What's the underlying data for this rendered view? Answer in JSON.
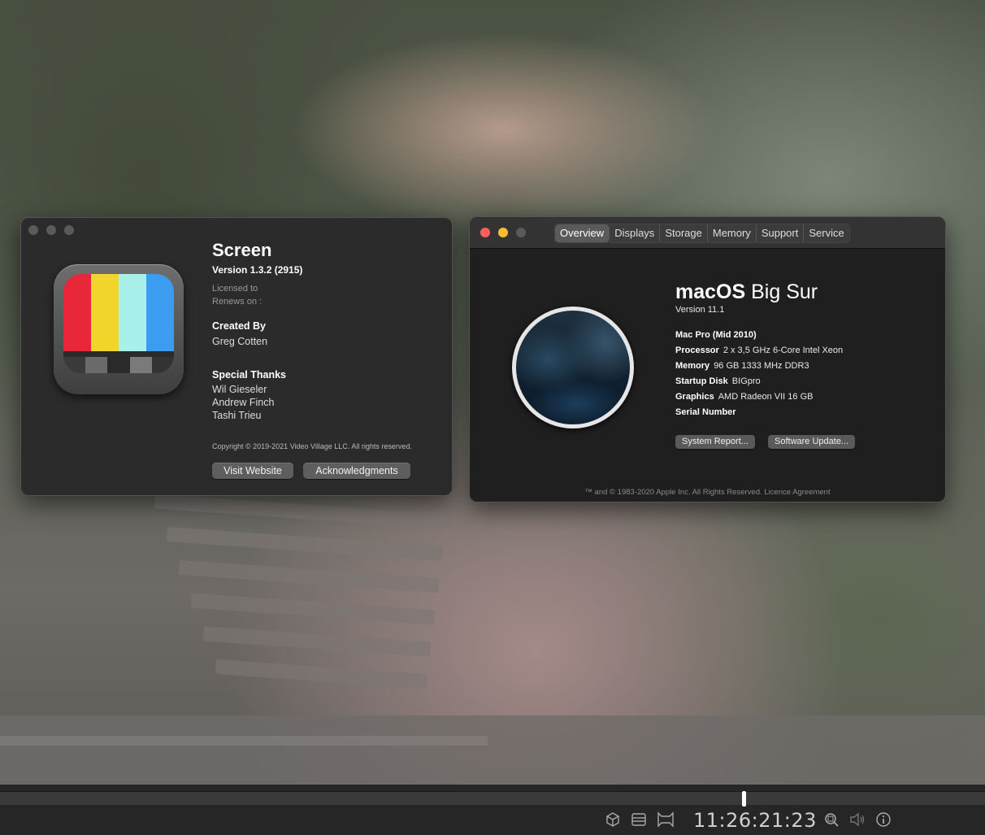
{
  "screen_about": {
    "app_name": "Screen",
    "version": "Version 1.3.2 (2915)",
    "licensed_to": "Licensed to",
    "renews_on": "Renews on :",
    "created_by_heading": "Created By",
    "created_by": "Greg Cotten",
    "thanks_heading": "Special Thanks",
    "thanks": [
      "Wil Gieseler",
      "Andrew Finch",
      "Tashi Trieu"
    ],
    "copyright": "Copyright © 2019-2021 Video Village LLC. All rights reserved.",
    "visit_website_label": "Visit Website",
    "acknowledgments_label": "Acknowledgments",
    "icon_colors": [
      "#e8283a",
      "#f2d52a",
      "#a8f0ea",
      "#3c9cf0"
    ]
  },
  "about_mac": {
    "tabs": [
      "Overview",
      "Displays",
      "Storage",
      "Memory",
      "Support",
      "Service"
    ],
    "active_tab": "Overview",
    "os_name_bold": "macOS",
    "os_name_rest": "Big Sur",
    "version": "Version 11.1",
    "model": "Mac Pro (Mid 2010)",
    "specs": [
      {
        "label": "Processor",
        "value": "2 x 3,5 GHz 6-Core Intel Xeon"
      },
      {
        "label": "Memory",
        "value": "96 GB 1333 MHz DDR3"
      },
      {
        "label": "Startup Disk",
        "value": "BIGpro"
      },
      {
        "label": "Graphics",
        "value": "AMD Radeon VII 16 GB"
      },
      {
        "label": "Serial Number",
        "value": ""
      }
    ],
    "system_report_label": "System Report...",
    "software_update_label": "Software Update...",
    "legal": "™ and © 1983-2020 Apple Inc. All Rights Reserved. Licence Agreement"
  },
  "player": {
    "timecode": "11:26:21:23",
    "progress_fraction": 0.756,
    "icons": [
      "cube-icon",
      "layout-icon",
      "frame-icon",
      "zoom-icon",
      "volume-icon",
      "info-icon"
    ]
  }
}
